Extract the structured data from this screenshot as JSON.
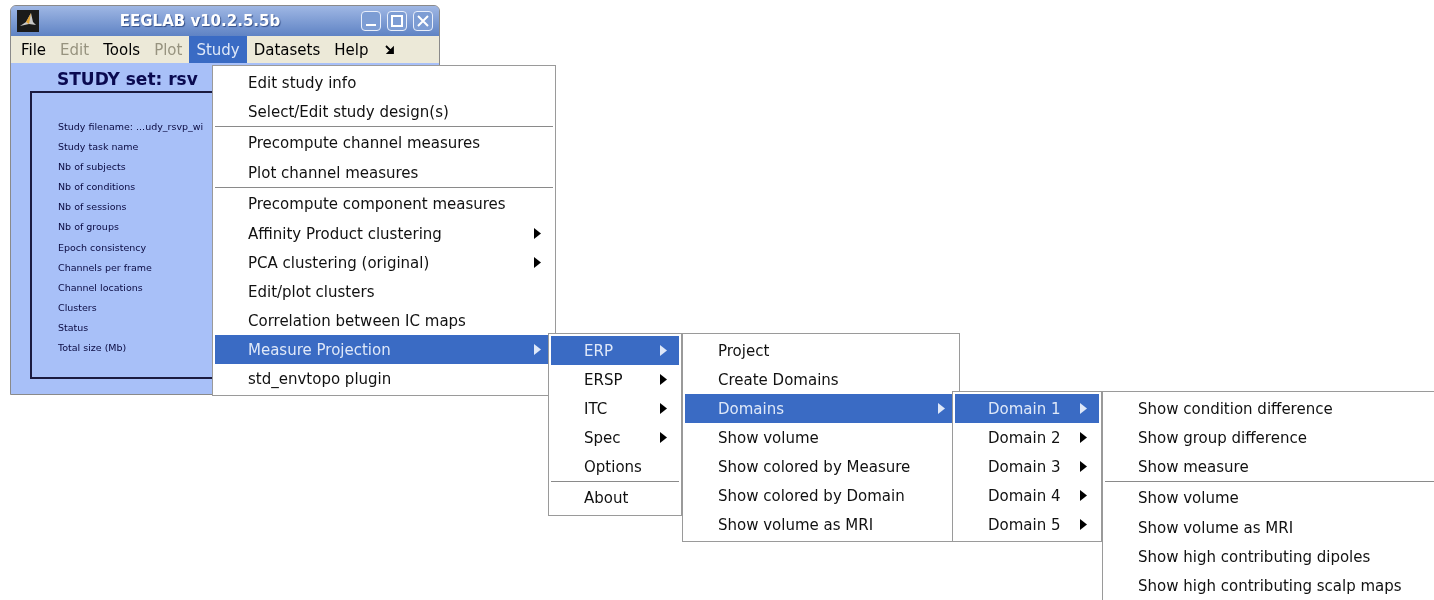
{
  "window": {
    "title": "EEGLAB v10.2.5.5b",
    "menu_bar": [
      {
        "label": "File",
        "disabled": false,
        "selected": false
      },
      {
        "label": "Edit",
        "disabled": true,
        "selected": false
      },
      {
        "label": "Tools",
        "disabled": false,
        "selected": false
      },
      {
        "label": "Plot",
        "disabled": true,
        "selected": false
      },
      {
        "label": "Study",
        "disabled": false,
        "selected": true
      },
      {
        "label": "Datasets",
        "disabled": false,
        "selected": false
      },
      {
        "label": "Help",
        "disabled": false,
        "selected": false
      }
    ],
    "study_panel": {
      "title": "STUDY set: rsv",
      "fields": [
        "Study filename: ...udy_rsvp_wi",
        "Study task name",
        "Nb of subjects",
        "Nb of conditions",
        "Nb of sessions",
        "Nb of groups",
        "Epoch consistency",
        "Channels per frame",
        "Channel locations",
        "Clusters",
        "Status",
        "Total size (Mb)"
      ]
    }
  },
  "menus": [
    {
      "items": [
        {
          "label": "Edit study info",
          "selected": false,
          "has_submenu": false,
          "separator_before": false
        },
        {
          "label": "Select/Edit study design(s)",
          "selected": false,
          "has_submenu": false,
          "separator_before": false
        },
        {
          "label": "Precompute channel measures",
          "selected": false,
          "has_submenu": false,
          "separator_before": true
        },
        {
          "label": "Plot channel measures",
          "selected": false,
          "has_submenu": false,
          "separator_before": false
        },
        {
          "label": "Precompute component measures",
          "selected": false,
          "has_submenu": false,
          "separator_before": true
        },
        {
          "label": "Affinity Product clustering",
          "selected": false,
          "has_submenu": true,
          "separator_before": false
        },
        {
          "label": "PCA clustering (original)",
          "selected": false,
          "has_submenu": true,
          "separator_before": false
        },
        {
          "label": "Edit/plot clusters",
          "selected": false,
          "has_submenu": false,
          "separator_before": false
        },
        {
          "label": "Correlation between IC maps",
          "selected": false,
          "has_submenu": false,
          "separator_before": false
        },
        {
          "label": "Measure Projection",
          "selected": true,
          "has_submenu": true,
          "separator_before": false
        },
        {
          "label": "std_envtopo plugin",
          "selected": false,
          "has_submenu": false,
          "separator_before": false
        }
      ]
    },
    {
      "items": [
        {
          "label": "ERP",
          "selected": true,
          "has_submenu": true,
          "separator_before": false
        },
        {
          "label": "ERSP",
          "selected": false,
          "has_submenu": true,
          "separator_before": false
        },
        {
          "label": "ITC",
          "selected": false,
          "has_submenu": true,
          "separator_before": false
        },
        {
          "label": "Spec",
          "selected": false,
          "has_submenu": true,
          "separator_before": false
        },
        {
          "label": "Options",
          "selected": false,
          "has_submenu": false,
          "separator_before": false
        },
        {
          "label": "About",
          "selected": false,
          "has_submenu": false,
          "separator_before": true
        }
      ]
    },
    {
      "items": [
        {
          "label": "Project",
          "selected": false,
          "has_submenu": false,
          "separator_before": false
        },
        {
          "label": "Create Domains",
          "selected": false,
          "has_submenu": false,
          "separator_before": false
        },
        {
          "label": "Domains",
          "selected": true,
          "has_submenu": true,
          "separator_before": false
        },
        {
          "label": "Show volume",
          "selected": false,
          "has_submenu": false,
          "separator_before": false
        },
        {
          "label": "Show colored by Measure",
          "selected": false,
          "has_submenu": false,
          "separator_before": false
        },
        {
          "label": "Show colored by Domain",
          "selected": false,
          "has_submenu": false,
          "separator_before": false
        },
        {
          "label": "Show volume as MRI",
          "selected": false,
          "has_submenu": false,
          "separator_before": false
        }
      ]
    },
    {
      "items": [
        {
          "label": "Domain 1",
          "selected": true,
          "has_submenu": true,
          "separator_before": false
        },
        {
          "label": "Domain 2",
          "selected": false,
          "has_submenu": true,
          "separator_before": false
        },
        {
          "label": "Domain 3",
          "selected": false,
          "has_submenu": true,
          "separator_before": false
        },
        {
          "label": "Domain 4",
          "selected": false,
          "has_submenu": true,
          "separator_before": false
        },
        {
          "label": "Domain 5",
          "selected": false,
          "has_submenu": true,
          "separator_before": false
        }
      ]
    },
    {
      "items": [
        {
          "label": "Show condition difference",
          "selected": false,
          "has_submenu": false,
          "separator_before": false
        },
        {
          "label": "Show group difference",
          "selected": false,
          "has_submenu": false,
          "separator_before": false
        },
        {
          "label": "Show measure",
          "selected": false,
          "has_submenu": false,
          "separator_before": false
        },
        {
          "label": "Show volume",
          "selected": false,
          "has_submenu": false,
          "separator_before": true
        },
        {
          "label": "Show volume as MRI",
          "selected": false,
          "has_submenu": false,
          "separator_before": false
        },
        {
          "label": "Show high contributing dipoles",
          "selected": false,
          "has_submenu": false,
          "separator_before": false
        },
        {
          "label": "Show high contributing scalp maps",
          "selected": false,
          "has_submenu": false,
          "separator_before": false
        }
      ]
    }
  ]
}
